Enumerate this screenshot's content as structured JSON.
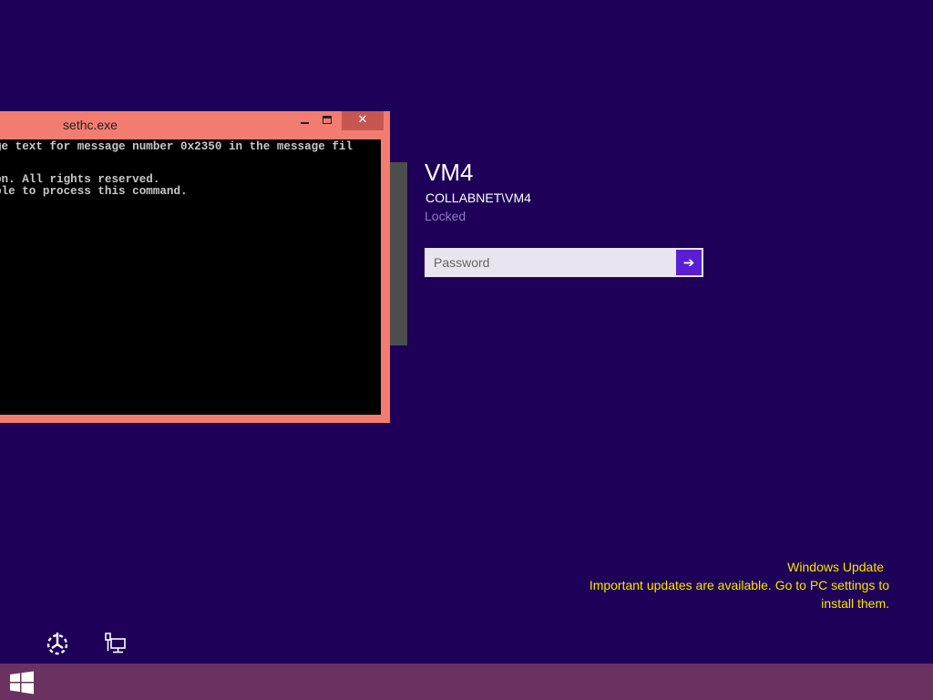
{
  "console": {
    "title": "sethc.exe",
    "close_glyph": "✕",
    "lines": [
      "ge text for message number 0x2350 in the message fil",
      "",
      "",
      "on. All rights reserved.",
      "ble to process this command.",
      "",
      ""
    ]
  },
  "lockscreen": {
    "user_name": "VM4",
    "domain_user": "COLLABNET\\VM4",
    "status": "Locked",
    "password_placeholder": "Password",
    "submit_glyph": "➔"
  },
  "notification": {
    "title": "Windows Update",
    "line1": "Important updates are available. Go to PC settings to",
    "line2": "install them."
  },
  "icons": {
    "ease_of_access": "ease-of-access-icon",
    "network": "network-icon",
    "start": "windows-logo-icon"
  },
  "colors": {
    "background": "#1f0058",
    "console_frame": "#f27c70",
    "close_button": "#c85650",
    "submit_button": "#5b1fd3",
    "notification_text": "#f4e600",
    "taskbar": "#6a3161",
    "status_text": "#8f7cc0"
  }
}
